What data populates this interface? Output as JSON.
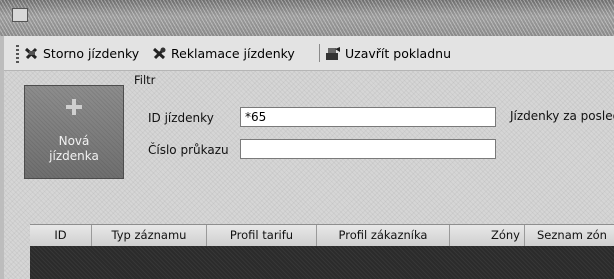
{
  "toolbar": {
    "storno_label": "Storno jízdenky",
    "reklamace_label": "Reklamace jízdenky",
    "uzavrit_label": "Uzavřít pokladnu"
  },
  "new_ticket": {
    "label": "Nová\njízdenka"
  },
  "filter": {
    "title": "Filtr",
    "ticket_id_label": "ID jízdenky",
    "ticket_id_value": "*65",
    "card_number_label": "Číslo průkazu",
    "card_number_value": "",
    "side_label": "Jízdenky za posled"
  },
  "grid": {
    "columns": [
      "ID",
      "Typ záznamu",
      "Profil tarifu",
      "Profil zákazníka",
      "Zóny",
      "Seznam zón"
    ]
  }
}
